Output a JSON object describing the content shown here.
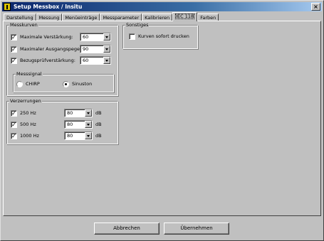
{
  "window": {
    "title": "Setup Messbox / Insitu",
    "close_label": "×"
  },
  "tabs": [
    {
      "label": "Darstellung",
      "active": false
    },
    {
      "label": "Messung",
      "active": false
    },
    {
      "label": "Menüeinträge",
      "active": false
    },
    {
      "label": "Messparameter",
      "active": false
    },
    {
      "label": "Kalibrieren",
      "active": false
    },
    {
      "label": "IEC 118",
      "active": true
    },
    {
      "label": "Farben",
      "active": false
    }
  ],
  "messkurven": {
    "title": "Messkurven",
    "items": [
      {
        "label": "Maximale Verstärkung:",
        "checked": true,
        "value": "60"
      },
      {
        "label": "Maximaler Ausgangspegel:",
        "checked": true,
        "value": "90"
      },
      {
        "label": "Bezugsprüfverstärkung:",
        "checked": true,
        "value": "60"
      }
    ],
    "messsignal": {
      "title": "Messsignal",
      "options": [
        {
          "label": "CHIRP",
          "selected": false
        },
        {
          "label": "Sinuston",
          "selected": true
        }
      ]
    }
  },
  "verzerrungen": {
    "title": "Verzerrungen",
    "unit": "dB",
    "items": [
      {
        "label": "250 Hz",
        "checked": true,
        "value": "80"
      },
      {
        "label": "500 Hz",
        "checked": true,
        "value": "80"
      },
      {
        "label": "1000 Hz",
        "checked": true,
        "value": "80"
      }
    ]
  },
  "sonstiges": {
    "title": "Sonstiges",
    "print_label": "Kurven sofort drucken",
    "print_checked": false
  },
  "buttons": {
    "cancel": "Abbrechen",
    "apply": "Übernehmen"
  },
  "check_glyph": "✓"
}
